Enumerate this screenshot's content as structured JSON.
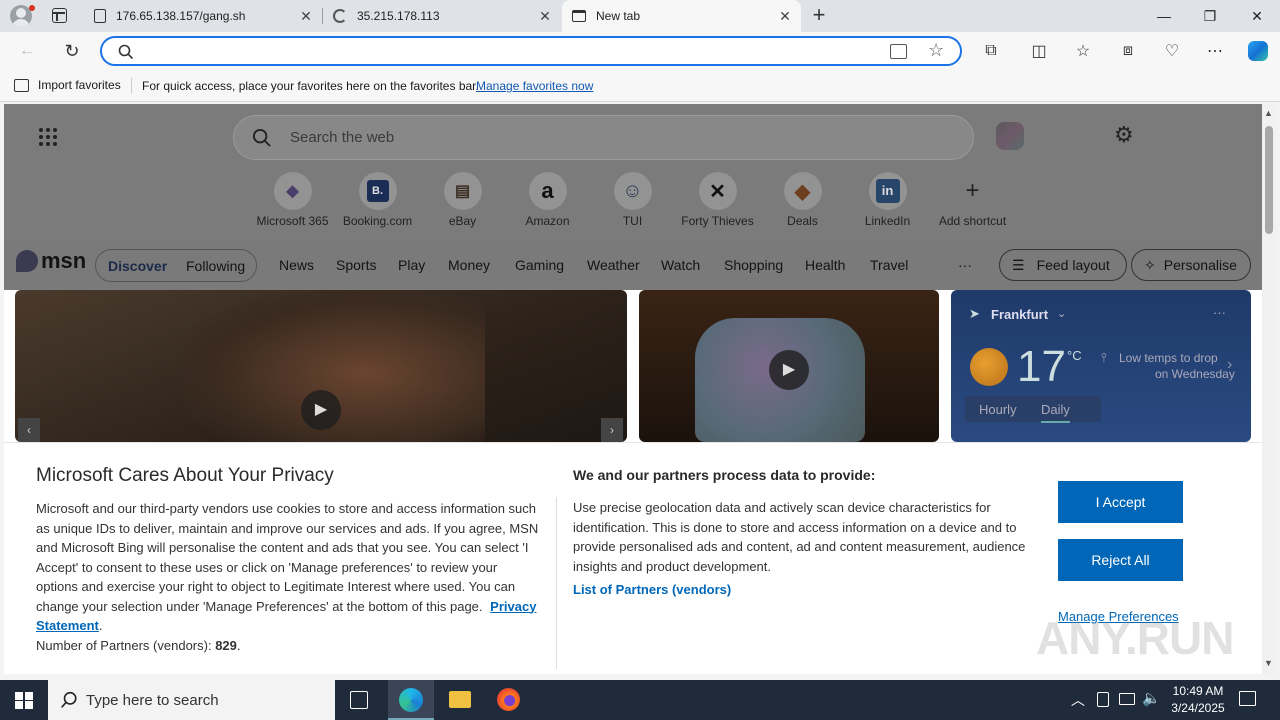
{
  "tabs": [
    {
      "title": "176.65.138.157/gang.sh",
      "close": "✕"
    },
    {
      "title": "35.215.178.113",
      "close": "✕"
    },
    {
      "title": "New tab",
      "close": "✕"
    }
  ],
  "new_tab_symbol": "+",
  "window_controls": {
    "minimize": "—",
    "restore": "❐",
    "close": "✕"
  },
  "favorites_bar": {
    "import_label": "Import favorites",
    "message": "For quick access, place your favorites here on the favorites bar.",
    "manage_link": "Manage favorites now"
  },
  "ntp": {
    "search_placeholder": "Search the web",
    "shortcuts": [
      {
        "label": "Microsoft 365",
        "glyph": "◆"
      },
      {
        "label": "Booking.com",
        "glyph": "B."
      },
      {
        "label": "eBay",
        "glyph": "▤"
      },
      {
        "label": "Amazon",
        "glyph": "a"
      },
      {
        "label": "TUI",
        "glyph": "☺"
      },
      {
        "label": "Forty Thieves",
        "glyph": "✕"
      },
      {
        "label": "Deals",
        "glyph": "◆"
      },
      {
        "label": "LinkedIn",
        "glyph": "in"
      },
      {
        "label": "Add shortcut",
        "glyph": "+"
      }
    ]
  },
  "msn": {
    "logo_text": "msn",
    "toggle": {
      "discover": "Discover",
      "following": "Following"
    },
    "nav": [
      "News",
      "Sports",
      "Play",
      "Money",
      "Gaming",
      "Weather",
      "Watch",
      "Shopping",
      "Health",
      "Travel"
    ],
    "more": "···",
    "feed_layout": "Feed layout",
    "personalise": "Personalise"
  },
  "weather": {
    "location": "Frankfurt",
    "temp": "17",
    "unit": "°C",
    "note_line1": "Low temps to drop",
    "note_line2": "on Wednesday",
    "tabs": [
      "Hourly",
      "Daily"
    ],
    "more": "···"
  },
  "privacy": {
    "title": "Microsoft Cares About Your Privacy",
    "body": "Microsoft and our third-party vendors use cookies to store and access information such as unique IDs to deliver, maintain and improve our services and ads. If you agree, MSN and Microsoft Bing will personalise the content and ads that you see. You can select 'I Accept' to consent to these uses or click on 'Manage preferences' to review your options and exercise your right to object to Legitimate Interest where used.  You can change your selection under 'Manage Preferences' at the bottom of this page.",
    "privacy_link": "Privacy Statement",
    "partners_label": "Number of Partners (vendors):",
    "partners_count": "829",
    "right_title": "We and our partners process data to provide:",
    "right_body": "Use precise geolocation data and actively scan device characteristics for identification. This is done to store and access information on a device and to provide personalised ads and content, ad and content measurement, audience insights and product development.",
    "partners_link": "List of Partners (vendors)",
    "accept": "I Accept",
    "reject": "Reject All",
    "manage": "Manage Preferences"
  },
  "taskbar": {
    "search_placeholder": "Type here to search",
    "time": "10:49 AM",
    "date": "3/24/2025"
  },
  "watermark": "ANY.RUN"
}
